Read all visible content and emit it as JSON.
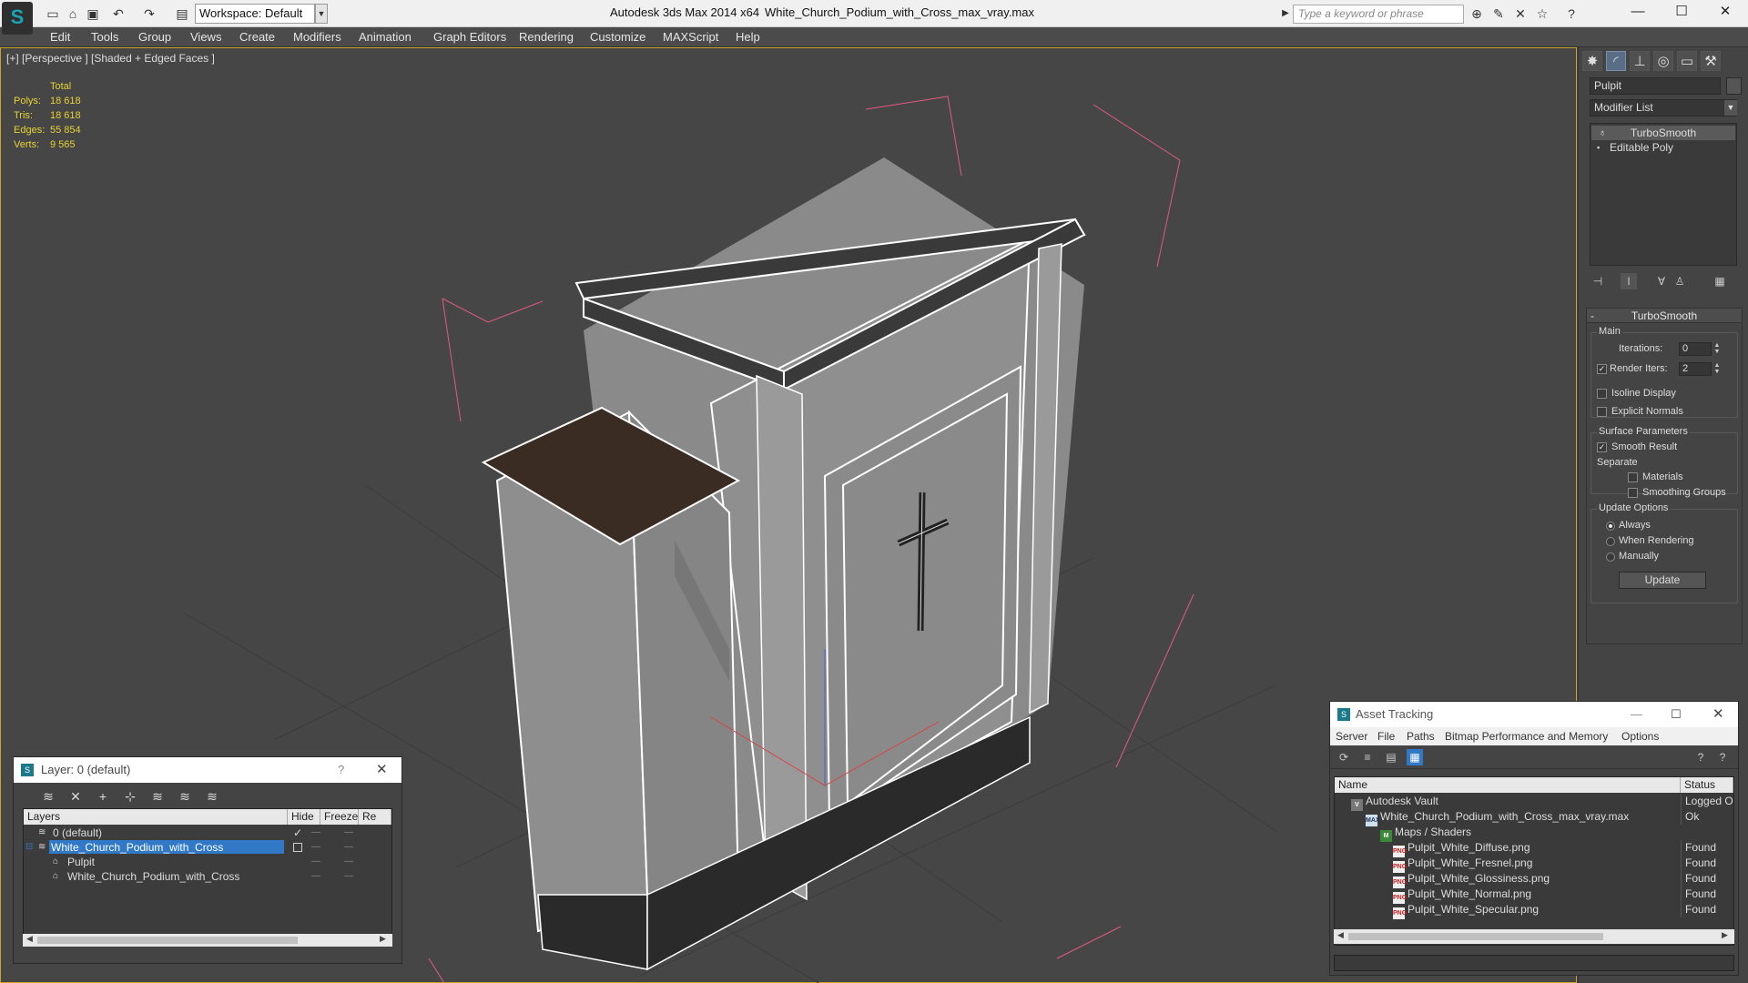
{
  "window": {
    "app_title": "Autodesk 3ds Max  2014 x64",
    "file_title": "White_Church_Podium_with_Cross_max_vray.max",
    "workspace_label": "Workspace: Default",
    "search_placeholder": "Type a keyword or phrase"
  },
  "menu": [
    "Edit",
    "Tools",
    "Group",
    "Views",
    "Create",
    "Modifiers",
    "Animation",
    "Graph Editors",
    "Rendering",
    "Customize",
    "MAXScript",
    "Help"
  ],
  "viewport": {
    "label": "[+] [Perspective ] [Shaded + Edged Faces ]",
    "stats": {
      "header": "Total",
      "rows": [
        {
          "k": "Polys:",
          "v": "18 618"
        },
        {
          "k": "Tris:",
          "v": "18 618"
        },
        {
          "k": "Edges:",
          "v": "55 854"
        },
        {
          "k": "Verts:",
          "v": "9 565"
        }
      ]
    }
  },
  "command_panel": {
    "object_name": "Pulpit",
    "modifier_list": "Modifier List",
    "stack": [
      "TurboSmooth",
      "Editable Poly"
    ],
    "rollout_title": "TurboSmooth",
    "main_label": "Main",
    "iterations_label": "Iterations:",
    "iterations_value": "0",
    "render_iters_label": "Render Iters:",
    "render_iters_value": "2",
    "isoline_label": "Isoline Display",
    "explicit_label": "Explicit Normals",
    "surface_label": "Surface Parameters",
    "smooth_label": "Smooth Result",
    "separate_label": "Separate",
    "materials_label": "Materials",
    "smoothing_label": "Smoothing Groups",
    "update_options_label": "Update Options",
    "always_label": "Always",
    "when_rendering_label": "When Rendering",
    "manually_label": "Manually",
    "update_button": "Update"
  },
  "layer_window": {
    "title": "Layer: 0 (default)",
    "help": "?",
    "columns": [
      "Layers",
      "Hide",
      "Freeze",
      "Re"
    ],
    "rows": [
      "0 (default)",
      "White_Church_Podium_with_Cross",
      "Pulpit",
      "White_Church_Podium_with_Cross"
    ]
  },
  "asset_window": {
    "title": "Asset Tracking",
    "menu": [
      "Server",
      "File",
      "Paths",
      "Bitmap Performance and Memory",
      "Options"
    ],
    "columns": [
      "Name",
      "Status"
    ],
    "rows": [
      {
        "name": "Autodesk Vault",
        "status": "Logged Out"
      },
      {
        "name": "White_Church_Podium_with_Cross_max_vray.max",
        "status": "Ok"
      },
      {
        "name": "Maps / Shaders",
        "status": ""
      },
      {
        "name": "Pulpit_White_Diffuse.png",
        "status": "Found"
      },
      {
        "name": "Pulpit_White_Fresnel.png",
        "status": "Found"
      },
      {
        "name": "Pulpit_White_Glossiness.png",
        "status": "Found"
      },
      {
        "name": "Pulpit_White_Normal.png",
        "status": "Found"
      },
      {
        "name": "Pulpit_White_Specular.png",
        "status": "Found"
      }
    ]
  },
  "colors": {
    "viewport_bg": "#464646",
    "stats_text": "#e6d233",
    "selection": "#3178c6",
    "bounding_box": "#e05a80",
    "wood_top": "#3a2c22"
  }
}
